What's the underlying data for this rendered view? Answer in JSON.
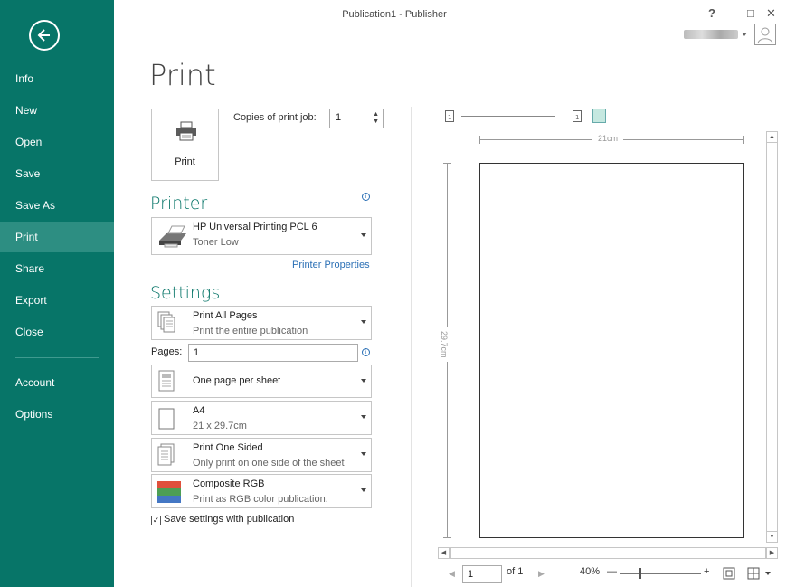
{
  "window": {
    "title": "Publication1 - Publisher",
    "help": "?",
    "minimize": "–",
    "maximize": "□",
    "close": "✕"
  },
  "sidebar": {
    "items": [
      {
        "label": "Info"
      },
      {
        "label": "New"
      },
      {
        "label": "Open"
      },
      {
        "label": "Save"
      },
      {
        "label": "Save As"
      },
      {
        "label": "Print"
      },
      {
        "label": "Share"
      },
      {
        "label": "Export"
      },
      {
        "label": "Close"
      },
      {
        "label": "Account"
      },
      {
        "label": "Options"
      }
    ],
    "active": "Print"
  },
  "main": {
    "title": "Print",
    "print_button": "Print",
    "copies_label": "Copies of print job:",
    "copies_value": "1",
    "printer_heading": "Printer",
    "printer": {
      "name": "HP Universal Printing PCL 6",
      "status": "Toner Low"
    },
    "printer_properties": "Printer Properties",
    "settings_heading": "Settings",
    "settings": {
      "range": {
        "title": "Print All Pages",
        "sub": "Print the entire publication"
      },
      "pages_label": "Pages:",
      "pages_value": "1",
      "layout": {
        "title": "One page per sheet"
      },
      "paper": {
        "title": "A4",
        "sub": "21 x 29.7cm"
      },
      "sides": {
        "title": "Print One Sided",
        "sub": "Only print on one side of the sheet"
      },
      "color": {
        "title": "Composite RGB",
        "sub": "Print as RGB color publication."
      },
      "save_with_publication": "Save settings with publication"
    }
  },
  "preview": {
    "width_label": "21cm",
    "height_label": "29.7cm",
    "page_value": "1",
    "of_pages": "of 1",
    "zoom": "40%",
    "zoom_minus": "—",
    "zoom_plus": "+"
  }
}
